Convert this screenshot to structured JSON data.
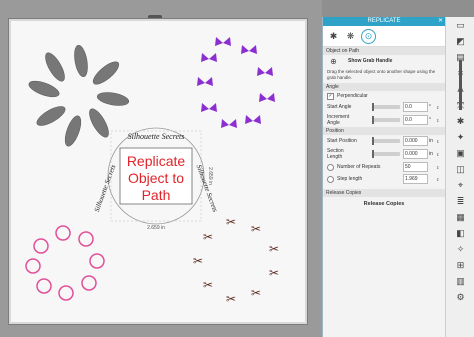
{
  "panel": {
    "title": "REPLICATE",
    "close": "✕",
    "section_object_on_path": "Object on Path",
    "show_grab_handle": "Show Grab Handle",
    "description": "Drag the selected object onto another shape using the grab handle.",
    "section_angle": "Angle",
    "perpendicular": "Perpendicular",
    "start_angle": "Start Angle",
    "start_angle_value": "0.0",
    "start_angle_unit": "°",
    "increment_angle": "Increment Angle",
    "increment_angle_value": "0.0",
    "increment_angle_unit": "°",
    "section_position": "Position",
    "start_position": "Start Position",
    "start_position_value": "0.000",
    "start_position_unit": "in",
    "section_length": "Section Length",
    "section_length_value": "0.000",
    "section_length_unit": "in",
    "number_of_repeats": "Number of Repeats",
    "number_of_repeats_value": "50",
    "step_length": "Step length",
    "step_length_value": "1.969",
    "section_release": "Release Copies",
    "release_copies": "Release Copies"
  },
  "canvas": {
    "dimension_right": "2.659 in",
    "dimension_bottom": "2.659 in",
    "center_text_lines": [
      "Replicate",
      "Object to",
      "Path"
    ],
    "path_text": "Silhouette Secrets",
    "colors": {
      "gray": "#777777",
      "purple": "#8c2fd1",
      "pink": "#e0509a",
      "brown": "#5a2b1f",
      "red": "#e0242a"
    }
  }
}
